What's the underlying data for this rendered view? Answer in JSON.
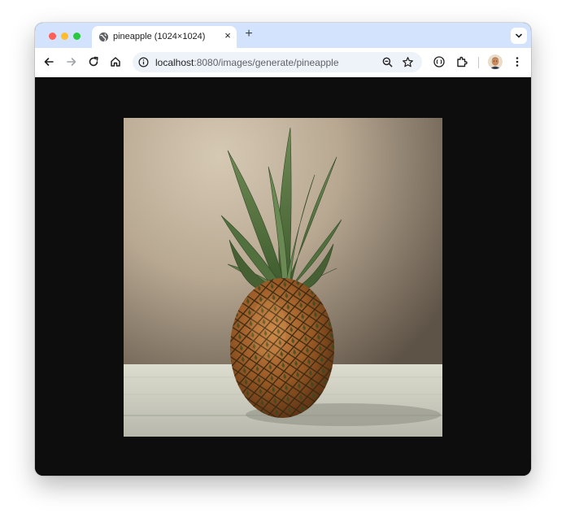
{
  "browser": {
    "tab": {
      "title": "pineapple (1024×1024)",
      "favicon": "globe-icon",
      "close_label": "×"
    },
    "new_tab_label": "+",
    "address": {
      "host": "localhost",
      "path": ":8080/images/generate/pineapple"
    },
    "icons": [
      "back-icon",
      "forward-icon",
      "reload-icon",
      "home-icon",
      "site-info-icon",
      "zoom-icon",
      "bookmark-star-icon",
      "extension-puzzle-icon",
      "account-avatar",
      "more-menu-icon",
      "tab-search-icon"
    ]
  },
  "image": {
    "subject": "pineapple",
    "background": "#0d0d0d"
  }
}
